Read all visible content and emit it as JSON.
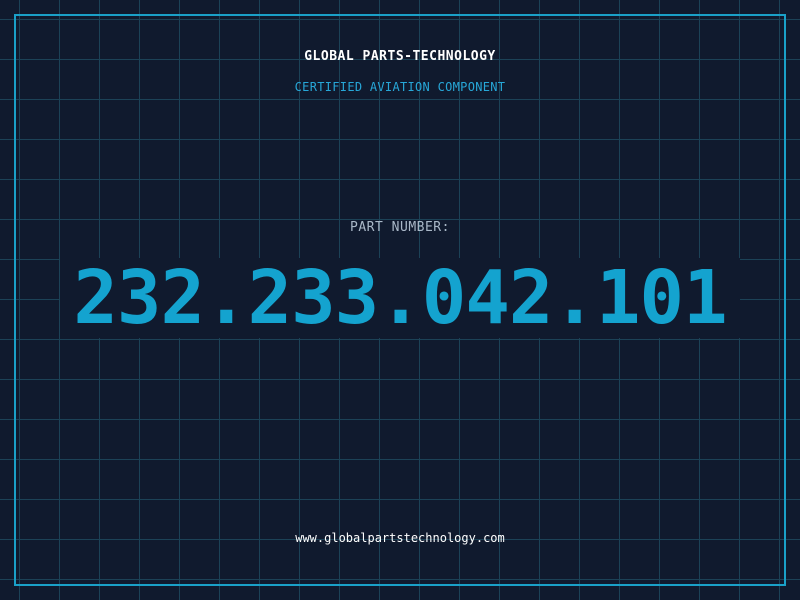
{
  "header": {
    "company": "GLOBAL PARTS-TECHNOLOGY",
    "subtitle": "CERTIFIED AVIATION COMPONENT"
  },
  "part": {
    "label": "PART NUMBER:",
    "number": "232.233.042.101"
  },
  "footer": {
    "url": "www.globalpartstechnology.com"
  },
  "colors": {
    "background": "#101a2e",
    "grid": "#1c4257",
    "accent": "#14a3cf",
    "frame": "#1aa0c8"
  }
}
